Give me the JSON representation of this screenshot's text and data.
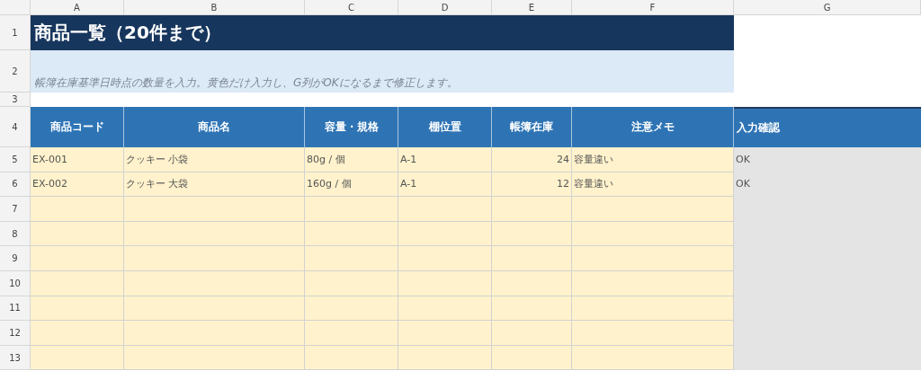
{
  "column_headers": [
    "A",
    "B",
    "C",
    "D",
    "E",
    "F",
    "G"
  ],
  "title": {
    "row": "1",
    "text": "商品一覧（20件まで）"
  },
  "note": {
    "row": "2",
    "text": "帳簿在庫基準日時点の数量を入力。黄色だけ入力し、G列がOKになるまで修正します。"
  },
  "spacer_row": "3",
  "table": {
    "row": "4",
    "columns": [
      {
        "label": "商品コード",
        "kind": "text"
      },
      {
        "label": "商品名",
        "kind": "text"
      },
      {
        "label": "容量・規格",
        "kind": "text"
      },
      {
        "label": "棚位置",
        "kind": "text"
      },
      {
        "label": "帳簿在庫",
        "kind": "number"
      },
      {
        "label": "注意メモ",
        "kind": "text"
      },
      {
        "label": "入力確認",
        "kind": "check"
      }
    ],
    "rows": [
      {
        "number": "5",
        "cells": [
          "EX-001",
          "クッキー 小袋",
          "80g / 個",
          "A-1",
          "24",
          "容量違い",
          "OK"
        ]
      },
      {
        "number": "6",
        "cells": [
          "EX-002",
          "クッキー 大袋",
          "160g / 個",
          "A-1",
          "12",
          "容量違い",
          "OK"
        ]
      },
      {
        "number": "7"
      },
      {
        "number": "8"
      },
      {
        "number": "9"
      },
      {
        "number": "10"
      },
      {
        "number": "11"
      },
      {
        "number": "12"
      },
      {
        "number": "13"
      }
    ]
  }
}
